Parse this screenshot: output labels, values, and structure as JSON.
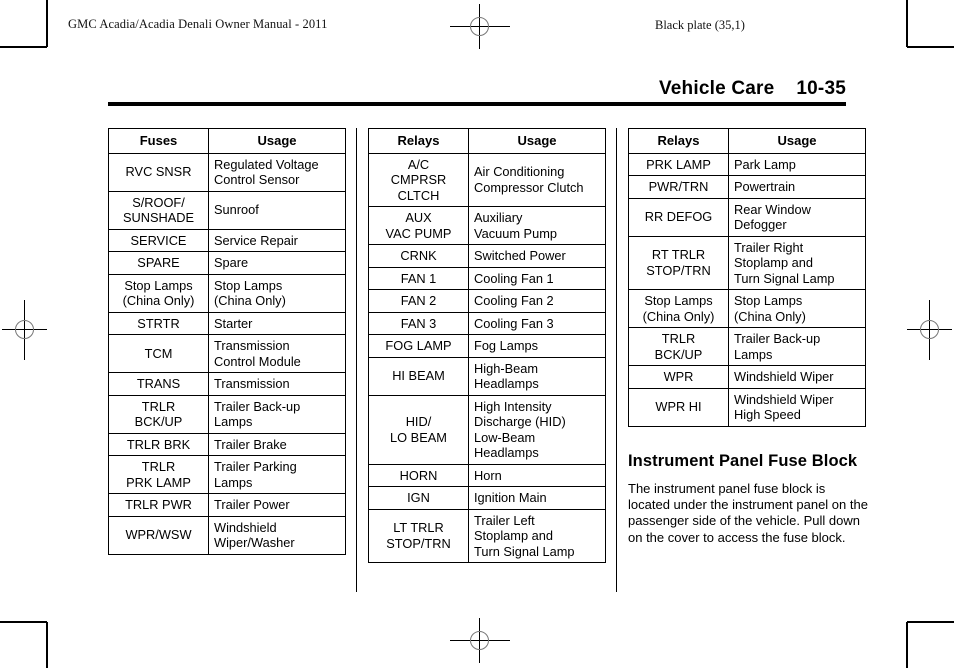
{
  "page": {
    "running_head": "GMC Acadia/Acadia Denali Owner Manual - 2011",
    "black_plate": "Black plate (35,1)",
    "header_title": "Vehicle Care",
    "page_number": "10-35"
  },
  "tables": [
    {
      "id": "table-fuses",
      "name": "fuses-table",
      "columns": [
        "Fuses",
        "Usage"
      ],
      "rows": [
        {
          "key": "RVC SNSR",
          "usage": "Regulated Voltage\nControl Sensor"
        },
        {
          "key": "S/ROOF/\nSUNSHADE",
          "usage": "Sunroof"
        },
        {
          "key": "SERVICE",
          "usage": "Service Repair"
        },
        {
          "key": "SPARE",
          "usage": "Spare"
        },
        {
          "key": "Stop Lamps\n(China Only)",
          "usage": "Stop Lamps\n(China Only)"
        },
        {
          "key": "STRTR",
          "usage": "Starter"
        },
        {
          "key": "TCM",
          "usage": "Transmission\nControl Module"
        },
        {
          "key": "TRANS",
          "usage": "Transmission"
        },
        {
          "key": "TRLR\nBCK/UP",
          "usage": "Trailer Back-up\nLamps"
        },
        {
          "key": "TRLR BRK",
          "usage": "Trailer Brake"
        },
        {
          "key": "TRLR\nPRK LAMP",
          "usage": "Trailer Parking\nLamps"
        },
        {
          "key": "TRLR PWR",
          "usage": "Trailer Power"
        },
        {
          "key": "WPR/WSW",
          "usage": "Windshield\nWiper/Washer"
        }
      ]
    },
    {
      "id": "table-relays-1",
      "name": "relays-table-1",
      "columns": [
        "Relays",
        "Usage"
      ],
      "rows": [
        {
          "key": "A/C\nCMPRSR\nCLTCH",
          "usage": "Air Conditioning\nCompressor Clutch"
        },
        {
          "key": "AUX\nVAC PUMP",
          "usage": "Auxiliary\nVacuum Pump"
        },
        {
          "key": "CRNK",
          "usage": "Switched Power"
        },
        {
          "key": "FAN 1",
          "usage": "Cooling Fan 1"
        },
        {
          "key": "FAN 2",
          "usage": "Cooling Fan 2"
        },
        {
          "key": "FAN 3",
          "usage": "Cooling Fan 3"
        },
        {
          "key": "FOG LAMP",
          "usage": "Fog Lamps"
        },
        {
          "key": "HI BEAM",
          "usage": "High-Beam\nHeadlamps"
        },
        {
          "key": "HID/\nLO BEAM",
          "usage": "High Intensity\nDischarge (HID)\nLow-Beam\nHeadlamps"
        },
        {
          "key": "HORN",
          "usage": "Horn"
        },
        {
          "key": "IGN",
          "usage": "Ignition Main"
        },
        {
          "key": "LT TRLR\nSTOP/TRN",
          "usage": "Trailer Left\nStoplamp and\nTurn Signal Lamp"
        }
      ]
    },
    {
      "id": "table-relays-2",
      "name": "relays-table-2",
      "columns": [
        "Relays",
        "Usage"
      ],
      "rows": [
        {
          "key": "PRK LAMP",
          "usage": "Park Lamp"
        },
        {
          "key": "PWR/TRN",
          "usage": "Powertrain"
        },
        {
          "key": "RR DEFOG",
          "usage": "Rear Window\nDefogger"
        },
        {
          "key": "RT TRLR\nSTOP/TRN",
          "usage": "Trailer Right\nStoplamp and\nTurn Signal Lamp"
        },
        {
          "key": "Stop Lamps\n(China Only)",
          "usage": "Stop Lamps\n(China Only)"
        },
        {
          "key": "TRLR\nBCK/UP",
          "usage": "Trailer Back-up\nLamps"
        },
        {
          "key": "WPR",
          "usage": "Windshield Wiper"
        },
        {
          "key": "WPR HI",
          "usage": "Windshield Wiper\nHigh Speed"
        }
      ]
    }
  ],
  "article": {
    "heading": "Instrument Panel Fuse Block",
    "body": "The instrument panel fuse block is located under the instrument panel on the passenger side of the vehicle. Pull down on the cover to access the fuse block."
  }
}
